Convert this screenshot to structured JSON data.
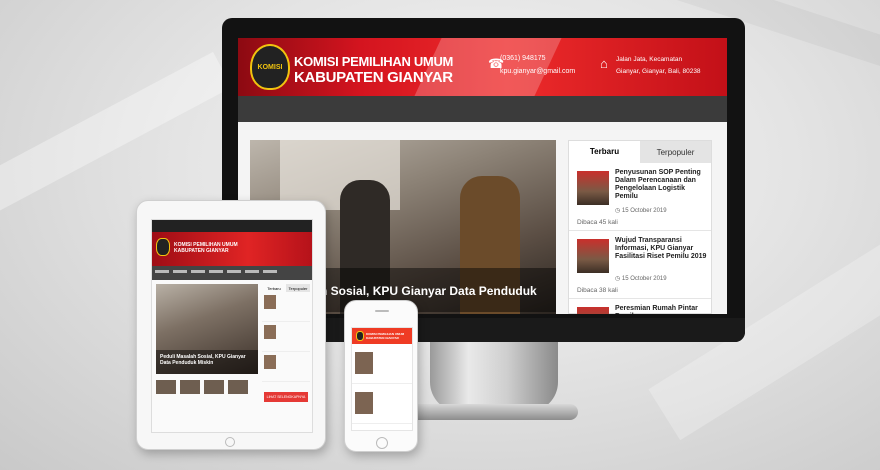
{
  "desktop": {
    "header": {
      "logo_text": "KOMISI",
      "title_line1": "KOMISI PEMILIHAN UMUM",
      "title_line2": "KABUPATEN GIANYAR",
      "phone": "(0361) 948175",
      "email": "kpu.gianyar@gmail.com",
      "address_line1": "Jalan Jata, Kecamatan",
      "address_line2": "Gianyar, Gianyar, Bali, 80238"
    },
    "hero_caption": "lah Sosial, KPU Gianyar Data Penduduk",
    "sidebar": {
      "tab_active": "Terbaru",
      "tab_inactive": "Terpopuler",
      "items": [
        {
          "title": "Penyusunan SOP Penting Dalam Perencanaan dan Pengelolaan Logistik Pemilu",
          "date": "15 October 2019",
          "reads": "Dibaca 45 kali"
        },
        {
          "title": "Wujud Transparansi Informasi, KPU Gianyar Fasilitasi Riset Pemilu 2019",
          "date": "15 October 2019",
          "reads": "Dibaca 38 kali"
        },
        {
          "title": "Peresmian Rumah Pintar Pemilu",
          "date": "",
          "reads": ""
        }
      ]
    }
  },
  "tablet": {
    "title_line1": "KOMISI PEMILIHAN UMUM",
    "title_line2": "KABUPATEN GIANYAR",
    "hero_caption": "Peduli Masalah Sosial, KPU Gianyar Data Penduduk Miskin",
    "tab_active": "Terbaru",
    "tab_inactive": "Terpopuler",
    "more_label": "LIHAT SELENGKAPNYA"
  },
  "phone": {
    "title": "KOMISI PEMILIHAN UMUM KABUPATEN GIANYAR"
  },
  "colors": {
    "brand_red": "#e02424",
    "nav_dark": "#3b3b3b",
    "accent_gold": "#f1c40f"
  }
}
